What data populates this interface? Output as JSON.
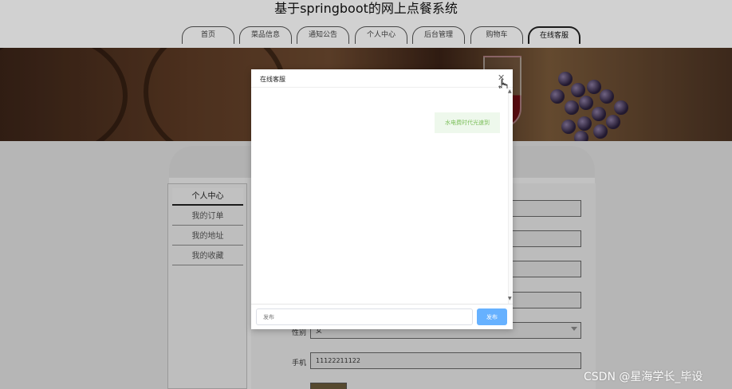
{
  "header": {
    "title": "基于springboot的网上点餐系统"
  },
  "nav": {
    "tabs": [
      {
        "label": "首页"
      },
      {
        "label": "菜品信息"
      },
      {
        "label": "通知公告"
      },
      {
        "label": "个人中心"
      },
      {
        "label": "后台管理"
      },
      {
        "label": "购物车"
      },
      {
        "label": "在线客服",
        "active": true
      }
    ]
  },
  "sidebar": {
    "items": [
      {
        "label": "个人中心",
        "active": true
      },
      {
        "label": "我的订单"
      },
      {
        "label": "我的地址"
      },
      {
        "label": "我的收藏"
      }
    ]
  },
  "form": {
    "gender_label": "性别",
    "gender_value": "女",
    "phone_label": "手机",
    "phone_value": "11122211122"
  },
  "dialog": {
    "title": "在线客服",
    "message": "水电费时代光速到",
    "input_placeholder": "发布",
    "send_label": "发布"
  },
  "watermark": "CSDN @星海学长_毕设"
}
